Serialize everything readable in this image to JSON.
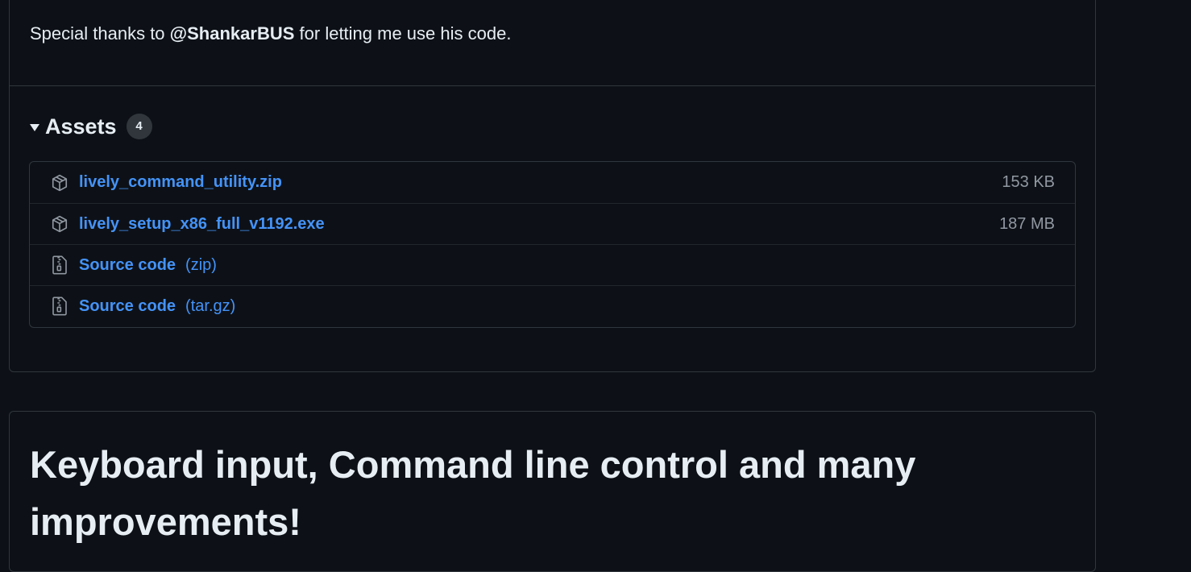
{
  "thanks": {
    "prefix": "Special thanks to",
    "mention": "@ShankarBUS",
    "suffix": "for letting me use his code."
  },
  "assets": {
    "title": "Assets",
    "count": "4",
    "items": [
      {
        "name": "lively_command_utility.zip",
        "ext": "",
        "size": "153 KB",
        "icon": "package-icon"
      },
      {
        "name": "lively_setup_x86_full_v1192.exe",
        "ext": "",
        "size": "187 MB",
        "icon": "package-icon"
      },
      {
        "name": "Source code",
        "ext": "(zip)",
        "size": "",
        "icon": "file-zip-icon"
      },
      {
        "name": "Source code",
        "ext": "(tar.gz)",
        "size": "",
        "icon": "file-zip-icon"
      }
    ]
  },
  "next_release": {
    "title": "Keyboard input, Command line control and many improvements!"
  },
  "colors": {
    "background": "#0d1117",
    "border": "#30363d",
    "link": "#4493f8",
    "muted": "#9198a1",
    "text": "#e6edf3"
  }
}
